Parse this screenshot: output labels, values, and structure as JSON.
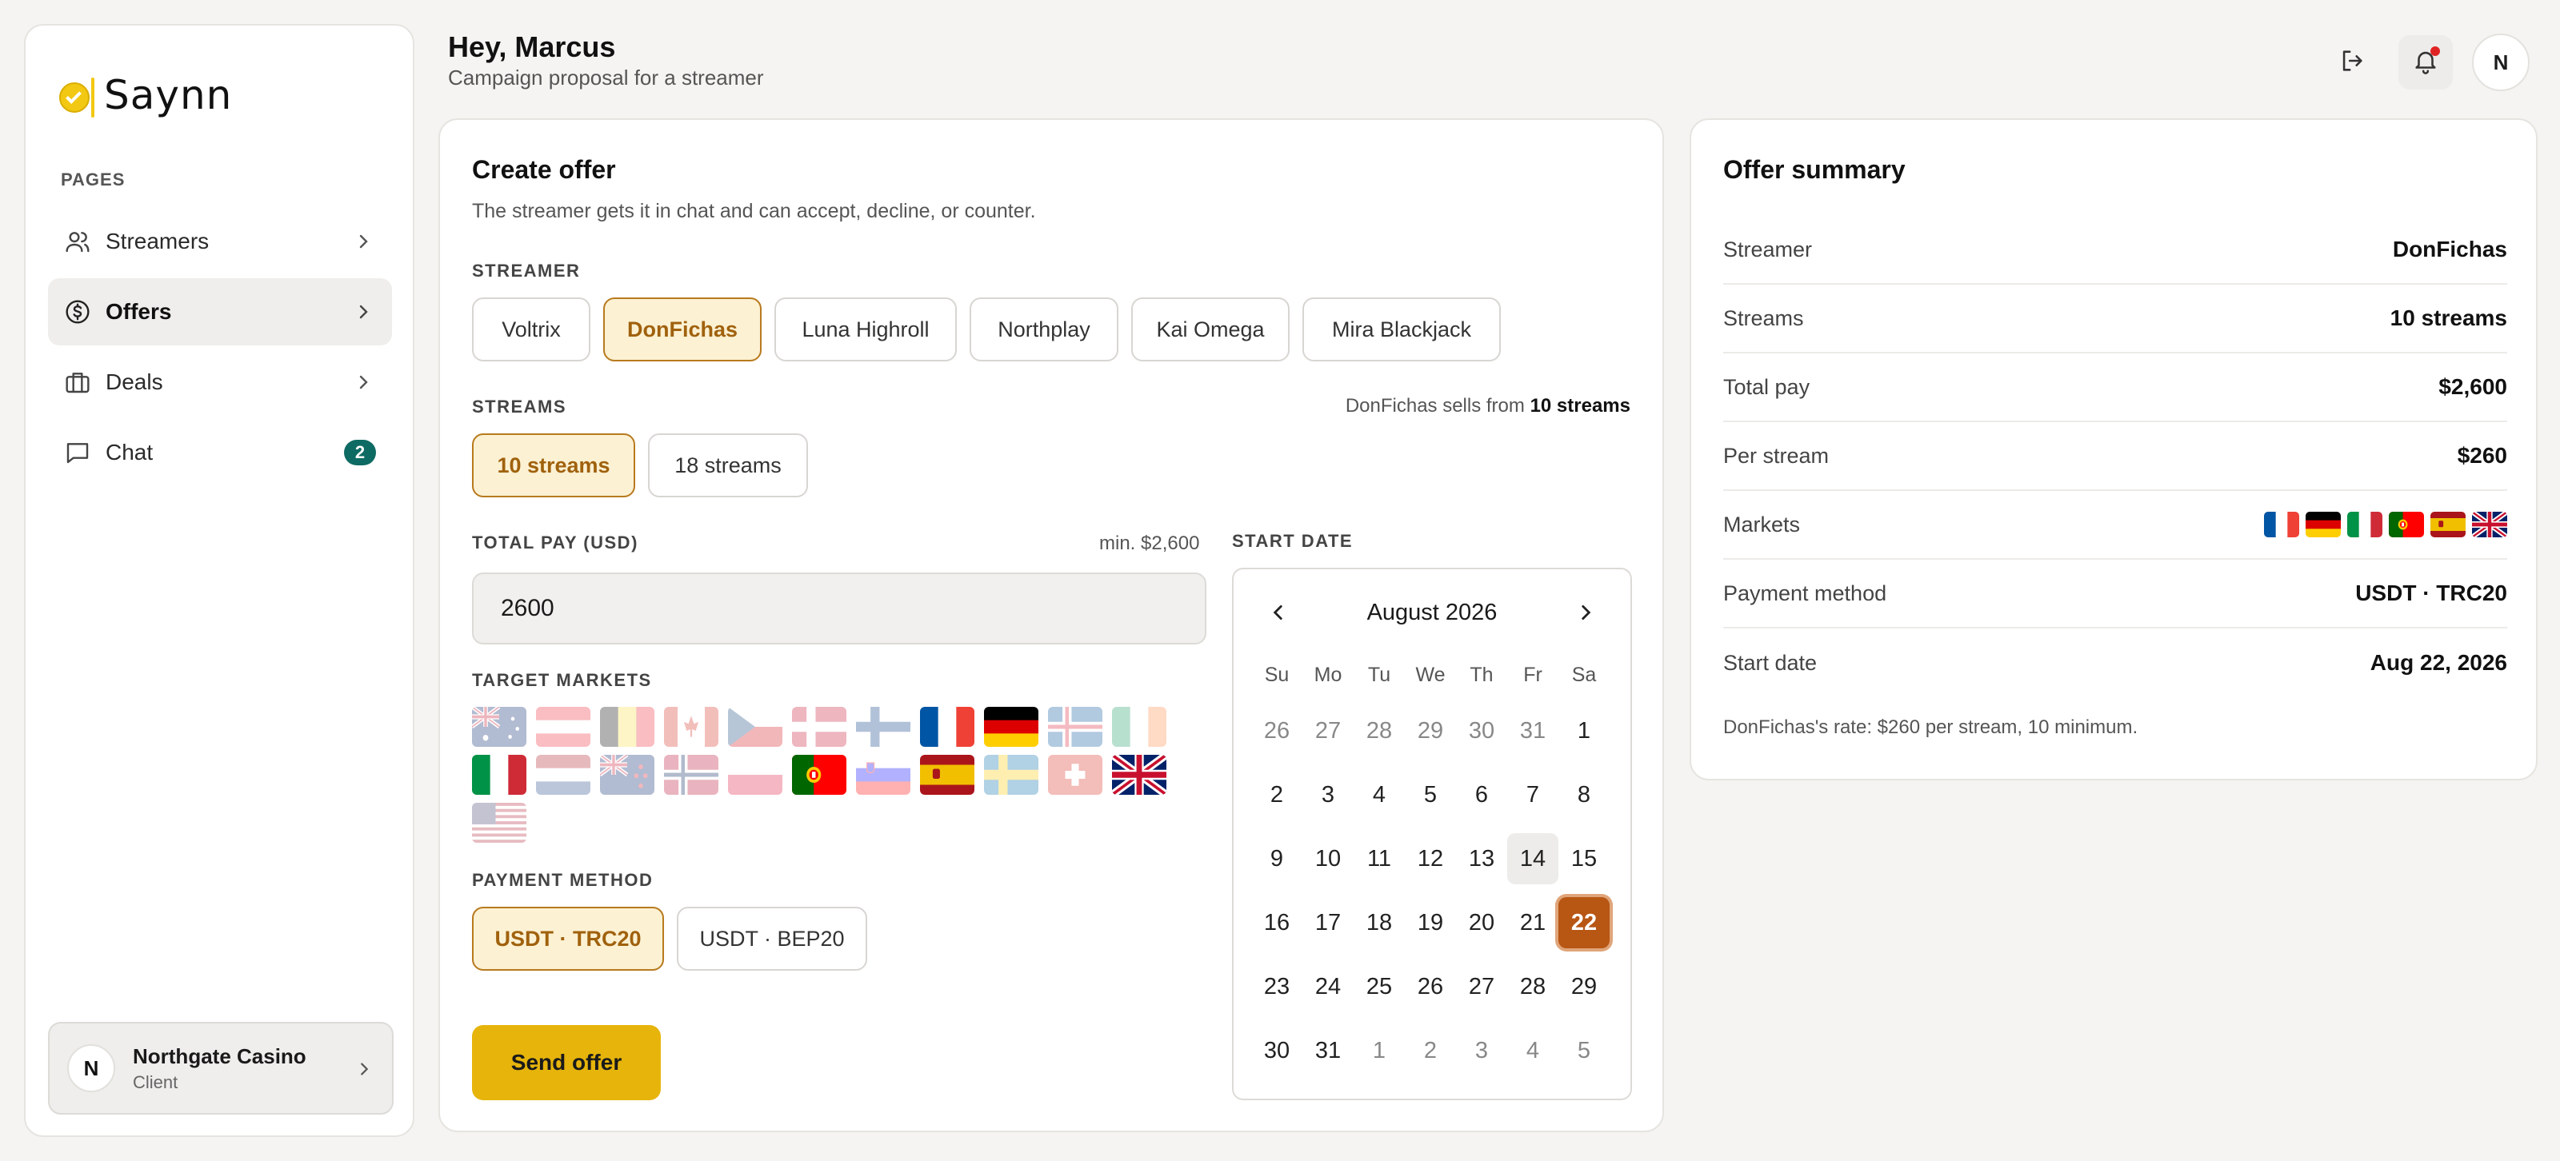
{
  "brand": {
    "name": "Saynn"
  },
  "sidebar": {
    "section_label": "PAGES",
    "items": [
      {
        "label": "Streamers",
        "icon": "users-icon"
      },
      {
        "label": "Offers",
        "icon": "dollar-circle-icon",
        "active": true
      },
      {
        "label": "Deals",
        "icon": "briefcase-icon"
      },
      {
        "label": "Chat",
        "icon": "chat-icon",
        "badge": "2"
      }
    ],
    "account": {
      "initial": "N",
      "name": "Northgate Casino",
      "role": "Client"
    }
  },
  "header": {
    "greeting": "Hey, Marcus",
    "subtitle": "Campaign proposal for a streamer",
    "avatar_initial": "N"
  },
  "offer": {
    "title": "Create offer",
    "description": "The streamer gets it in chat and can accept, decline, or counter.",
    "streamer_label": "STREAMER",
    "streamers": [
      "Voltrix",
      "DonFichas",
      "Luna Highroll",
      "Northplay",
      "Kai Omega",
      "Mira Blackjack"
    ],
    "selected_streamer": "DonFichas",
    "streams_label": "STREAMS",
    "streams_note_prefix": "DonFichas sells from",
    "streams_note_value": "10 streams",
    "stream_options": [
      "10 streams",
      "18 streams"
    ],
    "selected_streams": "10 streams",
    "pay_label": "TOTAL PAY (USD)",
    "pay_min": "min. $2,600",
    "pay_value": "2600",
    "markets_label": "TARGET MARKETS",
    "markets": [
      {
        "code": "au",
        "selected": false
      },
      {
        "code": "at",
        "selected": false
      },
      {
        "code": "be",
        "selected": false
      },
      {
        "code": "ca",
        "selected": false
      },
      {
        "code": "cz",
        "selected": false
      },
      {
        "code": "dk",
        "selected": false
      },
      {
        "code": "fi",
        "selected": false
      },
      {
        "code": "fr",
        "selected": true
      },
      {
        "code": "de",
        "selected": true
      },
      {
        "code": "is",
        "selected": false
      },
      {
        "code": "ie",
        "selected": false
      },
      {
        "code": "it",
        "selected": true
      },
      {
        "code": "nl",
        "selected": false
      },
      {
        "code": "nz",
        "selected": false
      },
      {
        "code": "no",
        "selected": false
      },
      {
        "code": "pl",
        "selected": false
      },
      {
        "code": "pt",
        "selected": true
      },
      {
        "code": "si",
        "selected": false
      },
      {
        "code": "es",
        "selected": true
      },
      {
        "code": "se",
        "selected": false
      },
      {
        "code": "ch",
        "selected": false
      },
      {
        "code": "gb",
        "selected": true
      },
      {
        "code": "us",
        "selected": false
      }
    ],
    "payment_label": "PAYMENT METHOD",
    "payment_options": [
      "USDT · TRC20",
      "USDT · BEP20"
    ],
    "selected_payment": "USDT · TRC20",
    "send_label": "Send offer",
    "start_date_label": "START DATE"
  },
  "calendar": {
    "month_label": "August 2026",
    "weekdays": [
      "Su",
      "Mo",
      "Tu",
      "We",
      "Th",
      "Fr",
      "Sa"
    ],
    "weeks": [
      [
        "26",
        "27",
        "28",
        "29",
        "30",
        "31",
        "1"
      ],
      [
        "2",
        "3",
        "4",
        "5",
        "6",
        "7",
        "8"
      ],
      [
        "9",
        "10",
        "11",
        "12",
        "13",
        "14",
        "15"
      ],
      [
        "16",
        "17",
        "18",
        "19",
        "20",
        "21",
        "22"
      ],
      [
        "23",
        "24",
        "25",
        "26",
        "27",
        "28",
        "29"
      ],
      [
        "30",
        "31",
        "1",
        "2",
        "3",
        "4",
        "5"
      ]
    ],
    "today": "14",
    "selected": "22"
  },
  "summary": {
    "title": "Offer summary",
    "rows": [
      {
        "key": "Streamer",
        "value": "DonFichas"
      },
      {
        "key": "Streams",
        "value": "10 streams"
      },
      {
        "key": "Total pay",
        "value": "$2,600"
      },
      {
        "key": "Per stream",
        "value": "$260"
      },
      {
        "key": "Markets",
        "value": ""
      },
      {
        "key": "Payment method",
        "value": "USDT · TRC20"
      },
      {
        "key": "Start date",
        "value": "Aug 22, 2026"
      }
    ],
    "market_flags": [
      "fr",
      "de",
      "it",
      "pt",
      "es",
      "gb"
    ],
    "note": "DonFichas's rate: $260 per stream, 10 minimum."
  },
  "colors": {
    "accent": "#e6b40b",
    "selected_chip_bg": "#fcf1d3",
    "selected_chip_border": "#b87a1e",
    "selected_date": "#b85614",
    "badge": "#0e6b63"
  }
}
